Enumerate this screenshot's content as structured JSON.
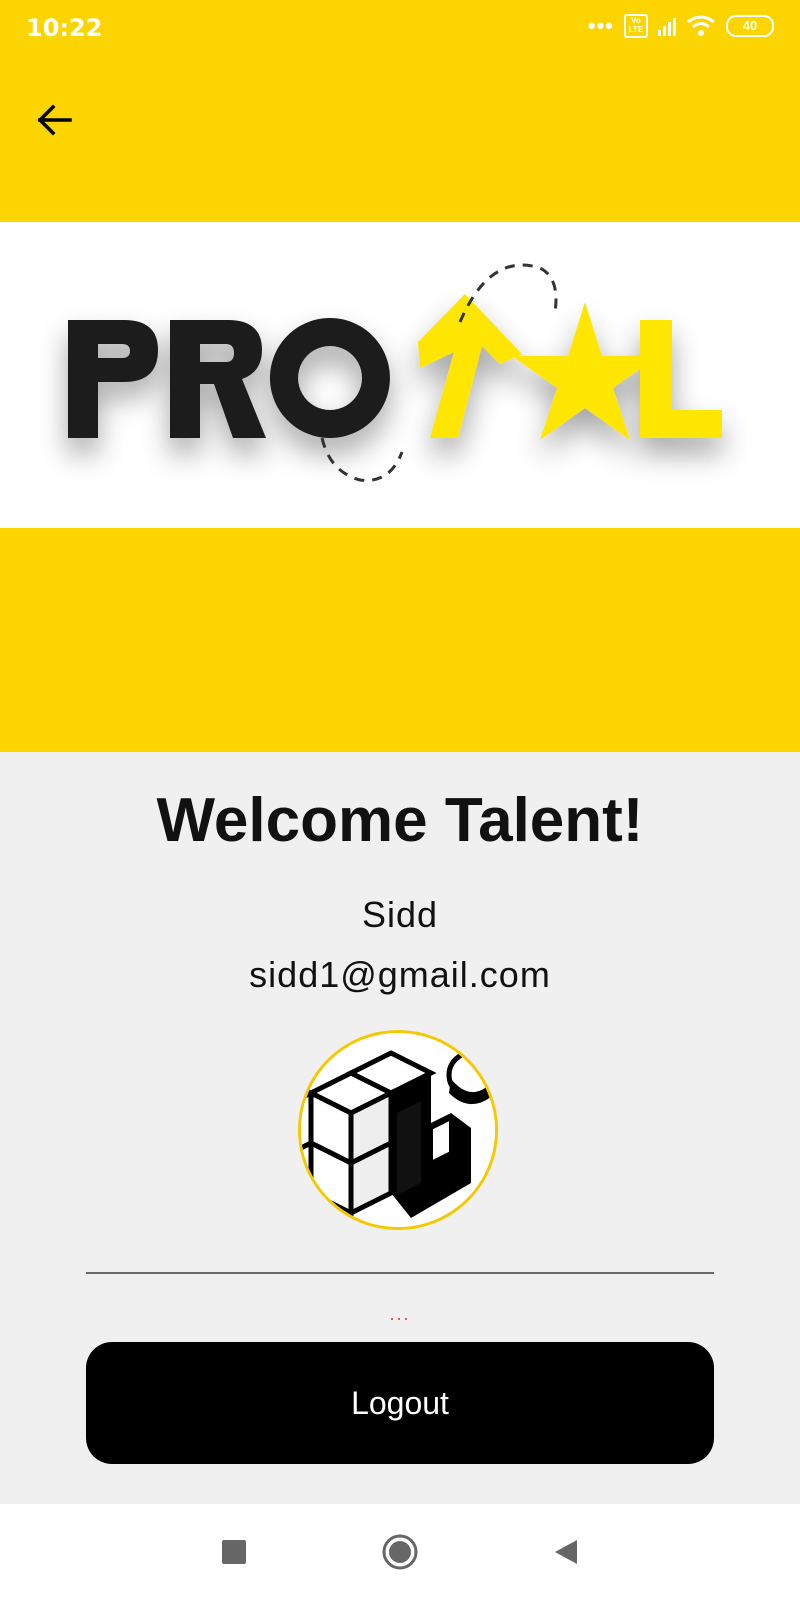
{
  "status_bar": {
    "time": "10:22",
    "volte_label": "Vo LTE",
    "battery": "40"
  },
  "header": {
    "back_icon": "arrow-left-icon"
  },
  "banner": {
    "logo_text": "PROTOOL",
    "logo_dark": "#1f1d1e",
    "logo_yellow": "#ffe600"
  },
  "colors": {
    "accent": "#fcd400",
    "background": "#f0f0f0",
    "button": "#000000",
    "error": "#e53935"
  },
  "profile": {
    "title": "Welcome Talent!",
    "name": "Sidd",
    "email": "sidd1@gmail.com",
    "status": "..."
  },
  "actions": {
    "logout_label": "Logout"
  },
  "nav": {
    "recents_icon": "square-icon",
    "home_icon": "circle-icon",
    "back_icon": "triangle-back-icon"
  }
}
